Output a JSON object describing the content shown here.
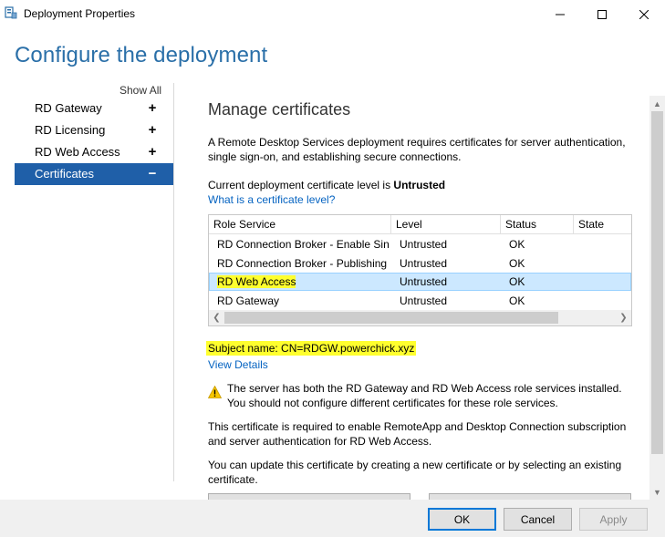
{
  "window": {
    "title": "Deployment Properties",
    "icons": {
      "app": "server-properties-icon",
      "minimize": "minimize-icon",
      "maximize": "maximize-icon",
      "close": "close-icon"
    }
  },
  "page_title": "Configure the deployment",
  "nav": {
    "show_all": "Show All",
    "items": [
      {
        "label": "RD Gateway",
        "sign": "+"
      },
      {
        "label": "RD Licensing",
        "sign": "+"
      },
      {
        "label": "RD Web Access",
        "sign": "+"
      },
      {
        "label": "Certificates",
        "sign": "−",
        "selected": true
      }
    ]
  },
  "content": {
    "heading": "Manage certificates",
    "description": "A Remote Desktop Services deployment requires certificates for server authentication, single sign-on, and establishing secure connections.",
    "level_prefix": "Current deployment certificate level is ",
    "level_value": "Untrusted",
    "level_link": "What is a certificate level?",
    "table": {
      "columns": [
        "Role Service",
        "Level",
        "Status",
        "State"
      ],
      "rows": [
        {
          "role": "RD Connection Broker - Enable Single Sign On",
          "level": "Untrusted",
          "status": "OK"
        },
        {
          "role": "RD Connection Broker - Publishing",
          "level": "Untrusted",
          "status": "OK"
        },
        {
          "role": "RD Web Access",
          "level": "Untrusted",
          "status": "OK",
          "selected": true
        },
        {
          "role": "RD Gateway",
          "level": "Untrusted",
          "status": "OK"
        }
      ]
    },
    "subject_name": "Subject name: CN=RDGW.powerchick.xyz",
    "view_details": "View Details",
    "warning": "The server has both the RD Gateway and RD Web Access role services installed. You should not configure different certificates for these role services.",
    "requirement": "This certificate is required to enable RemoteApp and Desktop Connection subscription and server authentication for RD Web Access.",
    "update_info": "You can update this certificate by creating a new certificate or by selecting an existing certificate."
  },
  "buttons": {
    "ok": "OK",
    "cancel": "Cancel",
    "apply": "Apply"
  },
  "colors": {
    "accent": "#1f5fa8",
    "title": "#2a6fa8",
    "link": "#0563c1",
    "highlight": "#ffff2e",
    "row_selected": "#cce8ff"
  }
}
